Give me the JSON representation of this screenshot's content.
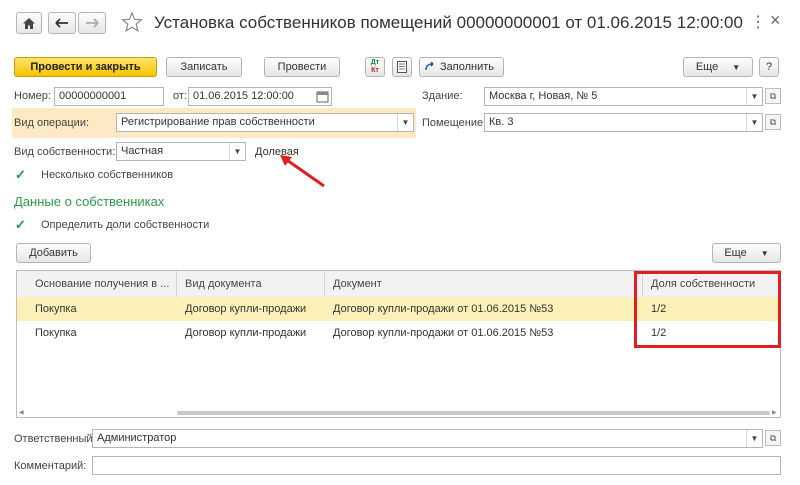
{
  "window": {
    "title": "Установка собственников помещений 00000000001 от 01.06.2015 12:00:00",
    "more_label": "⋮",
    "close_label": "×"
  },
  "toolbar": {
    "post_close": "Провести и закрыть",
    "save": "Записать",
    "post": "Провести",
    "fill": "Заполнить",
    "more": "Еще",
    "help": "?",
    "dtkt_top": "Дт",
    "dtkt_bottom": "Кт"
  },
  "form": {
    "number_label": "Номер:",
    "number_value": "00000000001",
    "date_label": "от:",
    "date_value": "01.06.2015 12:00:00",
    "building_label": "Здание:",
    "building_value": "Москва г, Новая,  № 5",
    "operation_label": "Вид операции:",
    "operation_value": "Регистрирование прав собственности",
    "room_label": "Помещение:",
    "room_value": "Кв. 3",
    "ownership_label": "Вид собственности:",
    "ownership_value": "Частная",
    "ownership_hint": "Долевая",
    "several_owners_label": "Несколько собственников",
    "section_title": "Данные о собственниках",
    "define_shares_label": "Определить доли собственности",
    "responsible_label": "Ответственный:",
    "responsible_value": "Администратор",
    "comment_label": "Комментарий:",
    "comment_value": ""
  },
  "table_toolbar": {
    "add": "Добавить",
    "more": "Еще"
  },
  "table": {
    "columns": [
      "Основание получения в ...",
      "Вид документа",
      "Документ",
      "Доля собственности"
    ],
    "rows": [
      [
        "Покупка",
        "Договор купли-продажи",
        "Договор купли-продажи от 01.06.2015 №53",
        "1/2"
      ],
      [
        "Покупка",
        "Договор купли-продажи",
        "Договор купли-продажи от 01.06.2015 №53",
        "1/2"
      ]
    ]
  },
  "colors": {
    "primary_button": "#f7c400",
    "section_title": "#2e9c4a",
    "highlight_row": "#fbf1b8",
    "operation_highlight": "#fde9c4",
    "annotation_red": "#e02020"
  }
}
